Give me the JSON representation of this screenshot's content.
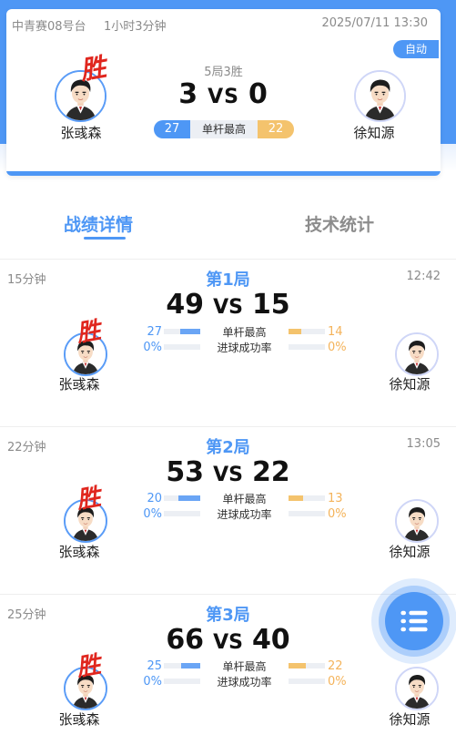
{
  "header": {
    "venue": "中青赛08号台",
    "duration": "1小时3分钟",
    "datetime": "2025/07/11 13:30",
    "auto_badge": "自动",
    "format": "5局3胜",
    "score_left": "3",
    "vs": "VS",
    "score_right": "0",
    "player_left": "张彧森",
    "player_right": "徐知源",
    "win_tag": "胜",
    "highest_break_label": "单杆最高",
    "highest_break_left": "27",
    "highest_break_right": "22"
  },
  "tabs": [
    {
      "label": "战绩详情",
      "active": true
    },
    {
      "label": "技术统计",
      "active": false
    }
  ],
  "frames": [
    {
      "duration": "15分钟",
      "time": "12:42",
      "label": "第1局",
      "score_left": "49",
      "vs": "VS",
      "score_right": "15",
      "player_left": "张彧森",
      "player_right": "徐知源",
      "win_tag": "胜",
      "break_label": "单杆最高",
      "break_left": "27",
      "break_right": "14",
      "break_left_fraction": 0.55,
      "break_right_fraction": 0.35,
      "rate_label": "进球成功率",
      "rate_left": "0%",
      "rate_right": "0%",
      "rate_left_fraction": 0,
      "rate_right_fraction": 0
    },
    {
      "duration": "22分钟",
      "time": "13:05",
      "label": "第2局",
      "score_left": "53",
      "vs": "VS",
      "score_right": "22",
      "player_left": "张彧森",
      "player_right": "徐知源",
      "win_tag": "胜",
      "break_label": "单杆最高",
      "break_left": "20",
      "break_right": "13",
      "break_left_fraction": 0.6,
      "break_right_fraction": 0.4,
      "rate_label": "进球成功率",
      "rate_left": "0%",
      "rate_right": "0%",
      "rate_left_fraction": 0,
      "rate_right_fraction": 0
    },
    {
      "duration": "25分钟",
      "time": "",
      "label": "第3局",
      "score_left": "66",
      "vs": "VS",
      "score_right": "40",
      "player_left": "张彧森",
      "player_right": "徐知源",
      "win_tag": "胜",
      "break_label": "单杆最高",
      "break_left": "25",
      "break_right": "22",
      "break_left_fraction": 0.53,
      "break_right_fraction": 0.47,
      "rate_label": "进球成功率",
      "rate_left": "0%",
      "rate_right": "0%",
      "rate_left_fraction": 0,
      "rate_right_fraction": 0
    }
  ],
  "fab": {
    "icon": "list-icon"
  },
  "colors": {
    "primary": "#4e97f5",
    "secondary": "#f4c36d",
    "win": "#e0261e"
  }
}
